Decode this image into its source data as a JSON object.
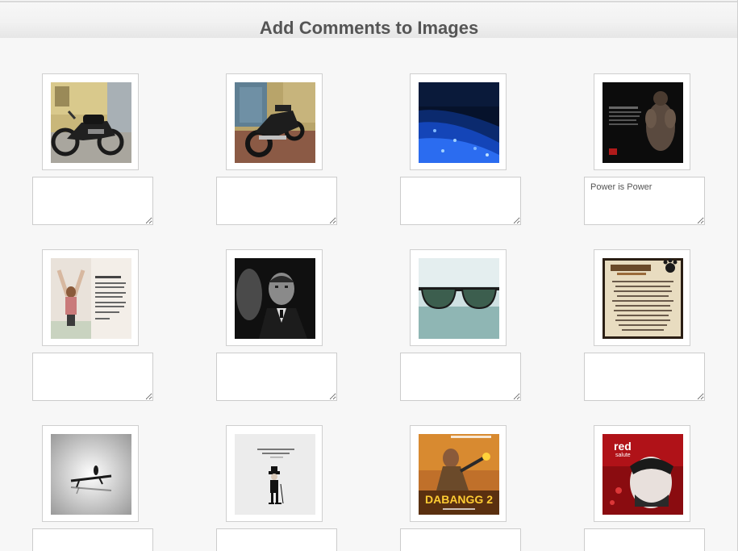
{
  "page": {
    "title": "Add Comments to Images"
  },
  "images": [
    {
      "id": "motorcycle-front",
      "comment": "",
      "placeholder": ""
    },
    {
      "id": "motorcycle-rear",
      "comment": "",
      "placeholder": ""
    },
    {
      "id": "glowing-beach",
      "comment": "",
      "placeholder": ""
    },
    {
      "id": "bodybuilder-poster",
      "comment": "Power is Power",
      "placeholder": ""
    },
    {
      "id": "woman-arms-raised",
      "comment": "",
      "placeholder": ""
    },
    {
      "id": "godfather-portrait",
      "comment": "",
      "placeholder": ""
    },
    {
      "id": "sunglasses-sea",
      "comment": "",
      "placeholder": ""
    },
    {
      "id": "pawprints-poem",
      "comment": "",
      "placeholder": ""
    },
    {
      "id": "bird-on-branch",
      "comment": "",
      "placeholder": ""
    },
    {
      "id": "chaplin-quote",
      "comment": "",
      "placeholder": ""
    },
    {
      "id": "dabangg-poster",
      "comment": "",
      "placeholder": ""
    },
    {
      "id": "red-salute-poster",
      "comment": "",
      "placeholder": ""
    }
  ],
  "logos": {
    "dabangg": "DABANGG 2",
    "red_salute_red": "red",
    "red_salute_sub": "salute"
  },
  "colors": {
    "background": "#f7f7f7",
    "title": "#555555",
    "frame_border": "#cfcfcf",
    "input_border": "#cccccc"
  }
}
